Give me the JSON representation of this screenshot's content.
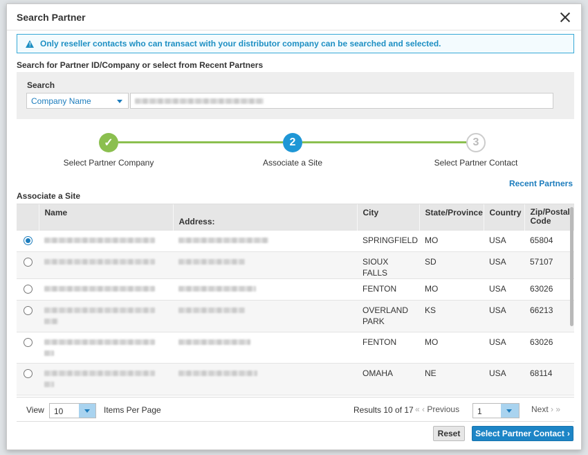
{
  "modal": {
    "title": "Search Partner",
    "banner": "Only reseller contacts who can transact with your distributor company can be searched and selected.",
    "instruction": "Search for Partner ID/Company or select from Recent Partners"
  },
  "search": {
    "label": "Search",
    "type_selected": "Company Name"
  },
  "steps": [
    {
      "number": "✓",
      "label": "Select Partner Company",
      "state": "done"
    },
    {
      "number": "2",
      "label": "Associate a Site",
      "state": "active"
    },
    {
      "number": "3",
      "label": "Select Partner Contact",
      "state": "pending"
    }
  ],
  "recent_link": "Recent Partners",
  "section_title": "Associate a Site",
  "table": {
    "headers": {
      "name": "Name",
      "address": "Address:",
      "city": "City",
      "state": "State/Province",
      "country": "Country",
      "zip": "Zip/Postal Code"
    },
    "rows": [
      {
        "city": "SPRINGFIELD",
        "state": "MO",
        "country": "USA",
        "zip": "65804",
        "selected": true
      },
      {
        "city": "SIOUX FALLS",
        "state": "SD",
        "country": "USA",
        "zip": "57107",
        "selected": false
      },
      {
        "city": "FENTON",
        "state": "MO",
        "country": "USA",
        "zip": "63026",
        "selected": false
      },
      {
        "city": "OVERLAND PARK",
        "state": "KS",
        "country": "USA",
        "zip": "66213",
        "selected": false
      },
      {
        "city": "FENTON",
        "state": "MO",
        "country": "USA",
        "zip": "63026",
        "selected": false
      },
      {
        "city": "OMAHA",
        "state": "NE",
        "country": "USA",
        "zip": "68114",
        "selected": false
      }
    ]
  },
  "pager": {
    "view_label": "View",
    "per_page": "10",
    "per_page_label": "Items Per Page",
    "results": "Results 10 of 17",
    "previous": "Previous",
    "page": "1",
    "next": "Next"
  },
  "footer": {
    "reset": "Reset",
    "next": "Select Partner Contact"
  },
  "colors": {
    "accent": "#1d85c6",
    "step_done": "#8bbf4f",
    "step_active": "#1f97d6"
  }
}
